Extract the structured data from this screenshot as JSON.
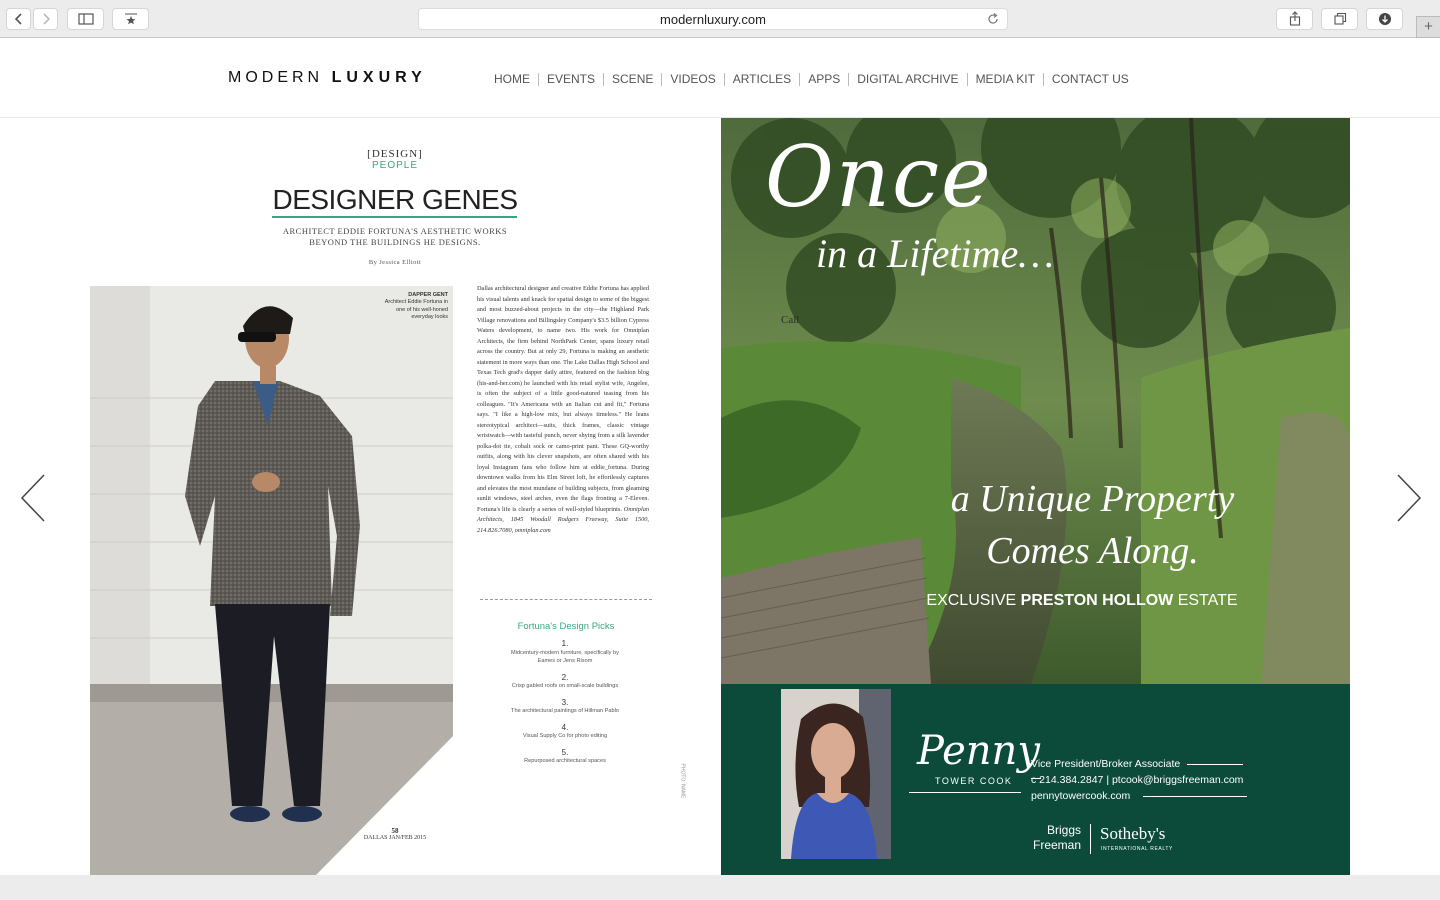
{
  "browser": {
    "url": "modernluxury.com"
  },
  "site": {
    "logo_light": "MODERN",
    "logo_bold": "LUXURY",
    "nav": [
      "HOME",
      "EVENTS",
      "SCENE",
      "VIDEOS",
      "ARTICLES",
      "APPS",
      "DIGITAL ARCHIVE",
      "MEDIA KIT",
      "CONTACT US"
    ]
  },
  "article": {
    "section": "[DESIGN]",
    "subsection": "PEOPLE",
    "headline": "DESIGNER GENES",
    "dek": "ARCHITECT EDDIE FORTUNA'S AESTHETIC WORKS BEYOND THE BUILDINGS HE DESIGNS.",
    "byline": "By Jessica Elliott",
    "caption_title": "DAPPER GENT",
    "caption_text": "Architect Eddie Fortuna in one of his well-honed everyday looks",
    "body": "Dallas architectural designer and creative Eddie Fortuna has applied his visual talents and knack for spatial design to some of the biggest and most buzzed-about projects in the city—the Highland Park Village renovations and Billingsley Company's $3.5 billion Cypress Waters development, to name two. His work for Omniplan Architects, the firm behind NorthPark Center, spans luxury retail across the country. But at only 29, Fortuna is making an aesthetic statement in more ways than one. The Lake Dallas High School and Texas Tech grad's dapper daily attire, featured on the fashion blog (his-and-her.com) he launched with his retail stylist wife, Angelee, is often the subject of a little good-natured teasing from his colleagues. \"It's Americana with an Italian cut and fit,\" Fortuna says. \"I like a high-low mix, but always timeless.\" He leans stereotypical architect—suits, thick frames, classic vintage wristwatch—with tasteful punch, never shying from a silk lavender polka-dot tie, cobalt sock or camo-print pant. These GQ-worthy outfits, along with his clever snapshots, are often shared with his loyal Instagram fans who follow him at eddie_fortuna. During downtown walks from his Elm Street loft, he effortlessly captures and elevates the most mundane of building subjects, from gleaming sunlit windows, steel arches, even the flags fronting a 7-Eleven. Fortuna's life is clearly a series of well-styled blueprints.",
    "body_credit": "Omniplan Architects, 1845 Woodall Rodgers Freeway, Suite 1500, 214.826.7080, omniplan.com",
    "picks_title": "Fortuna's Design Picks",
    "picks": [
      {
        "num": "1.",
        "text": "Midcentury-modern furniture, specifically by Eames or Jens Risom"
      },
      {
        "num": "2.",
        "text": "Crisp gabled roofs on small-scale buildings"
      },
      {
        "num": "3.",
        "text": "The architectural paintings of Hillman Pablo"
      },
      {
        "num": "4.",
        "text": "Visual Supply Co for photo editing"
      },
      {
        "num": "5.",
        "text": "Repurposed architectural spaces"
      }
    ],
    "page_number": "58",
    "issue": "DALLAS JAN/FEB 2015",
    "photo_credit": "PHOTO: NAME"
  },
  "ad": {
    "headline_1": "Once",
    "headline_2": "in a Lifetime…",
    "call": "Call",
    "headline_3": "a Unique Property",
    "headline_4": "Comes Along.",
    "exclusive_pre": "EXCLUSIVE ",
    "exclusive_bold": "PRESTON HOLLOW",
    "exclusive_post": " ESTATE",
    "agent_first": "Penny",
    "agent_last": "TOWER COOK",
    "agent_title": "Vice President/Broker Associate",
    "agent_contact": "c 214.384.2847 | ptcook@briggsfreeman.com",
    "agent_site": "pennytowercook.com",
    "broker_1": "Briggs",
    "broker_2": "Freeman",
    "broker_3": "Sotheby's",
    "broker_4": "INTERNATIONAL REALTY"
  },
  "colors": {
    "accent_green": "#3aa585",
    "ad_band": "#0c4a3a"
  },
  "icons": [
    "back-icon",
    "forward-icon",
    "sidebar-icon",
    "bookmarks-icon",
    "reload-icon",
    "share-icon",
    "tabs-icon",
    "download-icon",
    "new-tab-icon",
    "prev-page-icon",
    "next-page-icon"
  ]
}
